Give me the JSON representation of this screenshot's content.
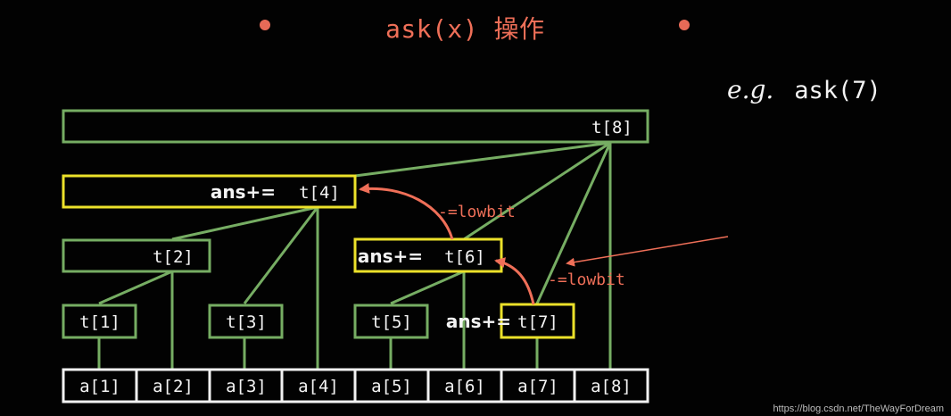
{
  "title": "ask(x) 操作",
  "example": {
    "prefix": "e.g.",
    "call": "ask(7)"
  },
  "colors": {
    "background": "#020202",
    "green": "#76ad63",
    "yellow": "#ece12a",
    "white": "#f2f2f2",
    "salmon": "#ef6f58"
  },
  "nodes": {
    "t8": "t[8]",
    "t4": "t[4]",
    "t2": "t[2]",
    "t6": "t[6]",
    "t1": "t[1]",
    "t3": "t[3]",
    "t5": "t[5]",
    "t7": "t[7]"
  },
  "ans_labels": {
    "t4": "ans+=",
    "t6": "ans+=",
    "t7": "ans+="
  },
  "array": [
    "a[1]",
    "a[2]",
    "a[3]",
    "a[4]",
    "a[5]",
    "a[6]",
    "a[7]",
    "a[8]"
  ],
  "arrows": {
    "upper": "-=lowbit",
    "lower": "-=lowbit"
  },
  "watermark": "https://blog.csdn.net/TheWayForDream"
}
